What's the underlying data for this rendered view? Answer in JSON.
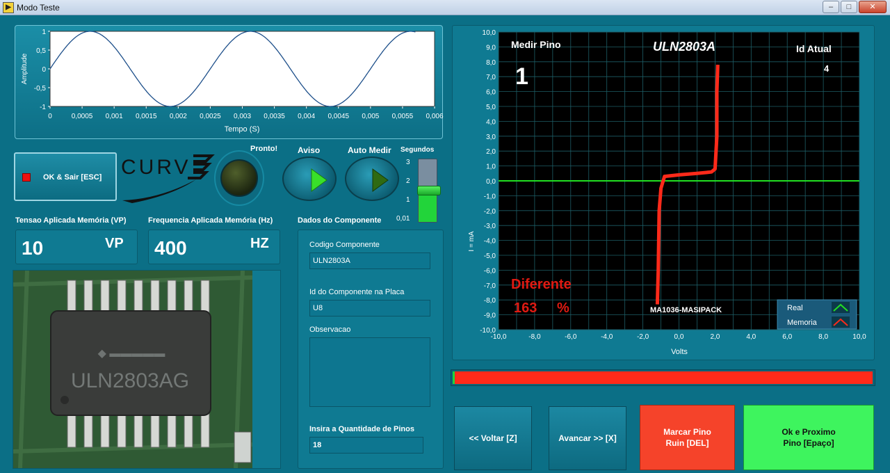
{
  "window": {
    "title": "Modo Teste",
    "min_label": "–",
    "max_label": "□",
    "close_label": "✕"
  },
  "wave_chart": {
    "xlabel": "Tempo (S)",
    "ylabel": "Amplitude",
    "x_ticks": [
      "0",
      "0,0005",
      "0,001",
      "0,0015",
      "0,002",
      "0,0025",
      "0,003",
      "0,0035",
      "0,004",
      "0,0045",
      "0,005",
      "0,0055",
      "0,006"
    ],
    "y_ticks": [
      "1",
      "0,5",
      "0",
      "-0,5",
      "-1"
    ]
  },
  "ok_exit_button": "OK & Sair [ESC]",
  "logo_text": "CURV",
  "leds": {
    "pronto": "Pronto!",
    "aviso": "Aviso",
    "auto_medir": "Auto Medir"
  },
  "segundos": {
    "label": "Segundos",
    "ticks": [
      "3",
      "2",
      "1",
      "0,01"
    ],
    "value": 1.6
  },
  "tensao": {
    "label": "Tensao Aplicada Memória (VP)",
    "value": "10",
    "unit": "VP"
  },
  "frequencia": {
    "label": "Frequencia Aplicada Memória (Hz)",
    "value": "400",
    "unit": "HZ"
  },
  "dados": {
    "title": "Dados do Componente",
    "codigo_label": "Codigo Componente",
    "codigo_value": "ULN2803A",
    "id_label": "Id do Componente na Placa",
    "id_value": "U8",
    "obs_label": "Observacao",
    "obs_value": "",
    "pinos_label": "Insira a Quantidade de Pinos",
    "pinos_value": "18"
  },
  "chip_photo": {
    "marking_line1": "ULN2803AG"
  },
  "curve_chart": {
    "medir_pino_label": "Medir Pino",
    "medir_pino_value": "1",
    "component_title": "ULN2803A",
    "id_atual_label": "Id Atual",
    "id_atual_value": "4",
    "status_text": "Diferente",
    "status_percent": "163",
    "status_percent_unit": "%",
    "machine_label": "MA1036-MASIPACK",
    "xlabel": "Volts",
    "ylabel": "I = mA",
    "x_ticks": [
      "-10,0",
      "-8,0",
      "-6,0",
      "-4,0",
      "-2,0",
      "0,0",
      "2,0",
      "4,0",
      "6,0",
      "8,0",
      "10,0"
    ],
    "y_ticks": [
      "10,0",
      "9,0",
      "8,0",
      "7,0",
      "6,0",
      "5,0",
      "4,0",
      "3,0",
      "2,0",
      "1,0",
      "0,0",
      "-1,0",
      "-2,0",
      "-3,0",
      "-4,0",
      "-5,0",
      "-6,0",
      "-7,0",
      "-8,0",
      "-9,0",
      "-10,0"
    ],
    "legend": [
      {
        "name": "Real",
        "color": "#22e022"
      },
      {
        "name": "Memoria",
        "color": "#ff2a1a"
      }
    ]
  },
  "chart_data": {
    "type": "line",
    "xlabel": "Volts",
    "ylabel": "I = mA",
    "title": "ULN2803A",
    "xlim": [
      -10,
      10
    ],
    "ylim": [
      -10,
      10
    ],
    "grid": true,
    "legend_position": "bottom-right",
    "series": [
      {
        "name": "Real",
        "color": "#22e022",
        "x": [
          -10,
          10
        ],
        "y": [
          0,
          0
        ]
      },
      {
        "name": "Memoria",
        "color": "#ff2a1a",
        "x": [
          -1.2,
          -1.15,
          -1.1,
          -1.0,
          -0.8,
          0.0,
          1.0,
          1.8,
          2.0,
          2.1,
          2.1,
          2.15
        ],
        "y": [
          -8.3,
          -6.0,
          -2.0,
          -0.5,
          0.3,
          0.4,
          0.5,
          0.6,
          0.8,
          3.0,
          6.0,
          7.8
        ]
      }
    ]
  },
  "progress": {
    "value": 1.0,
    "color": "#ff2a1a"
  },
  "buttons": {
    "voltar": "<< Voltar  [Z]",
    "avancar": "Avancar >> [X]",
    "marcar_line1": "Marcar Pino",
    "marcar_line2": "Ruin [DEL]",
    "ok_proximo_line1": "Ok e Proximo",
    "ok_proximo_line2": "Pino  [Epaço]"
  }
}
